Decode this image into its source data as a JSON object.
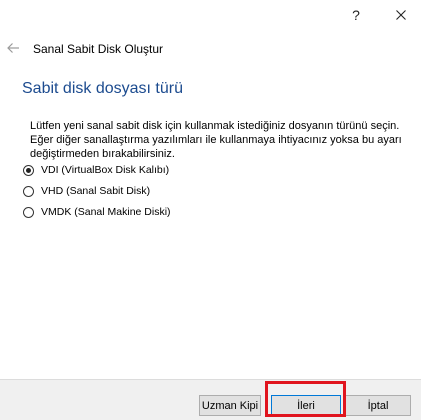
{
  "titlebar": {
    "help_label": "?",
    "close_icon": "close-icon"
  },
  "header": {
    "back_icon": "back-arrow-icon",
    "title": "Sanal Sabit Disk Oluştur"
  },
  "page": {
    "heading": "Sabit disk dosyası türü",
    "description": "Lütfen yeni sanal sabit disk için kullanmak istediğiniz dosyanın türünü seçin. Eğer diğer sanallaştırma yazılımları ile kullanmaya ihtiyacınız yoksa bu ayarı değiştirmeden bırakabilirsiniz."
  },
  "options": [
    {
      "label": "VDI (VirtualBox Disk Kalıbı)",
      "checked": true
    },
    {
      "label": "VHD (Sanal Sabit Disk)",
      "checked": false
    },
    {
      "label": "VMDK (Sanal Makine Diski)",
      "checked": false
    }
  ],
  "footer": {
    "expert_label": "Uzman Kipi",
    "next_label": "İleri",
    "cancel_label": "İptal"
  },
  "colors": {
    "heading": "#1c4b8f",
    "highlight": "#e0141e",
    "footer_bg": "#f0f0f0"
  }
}
